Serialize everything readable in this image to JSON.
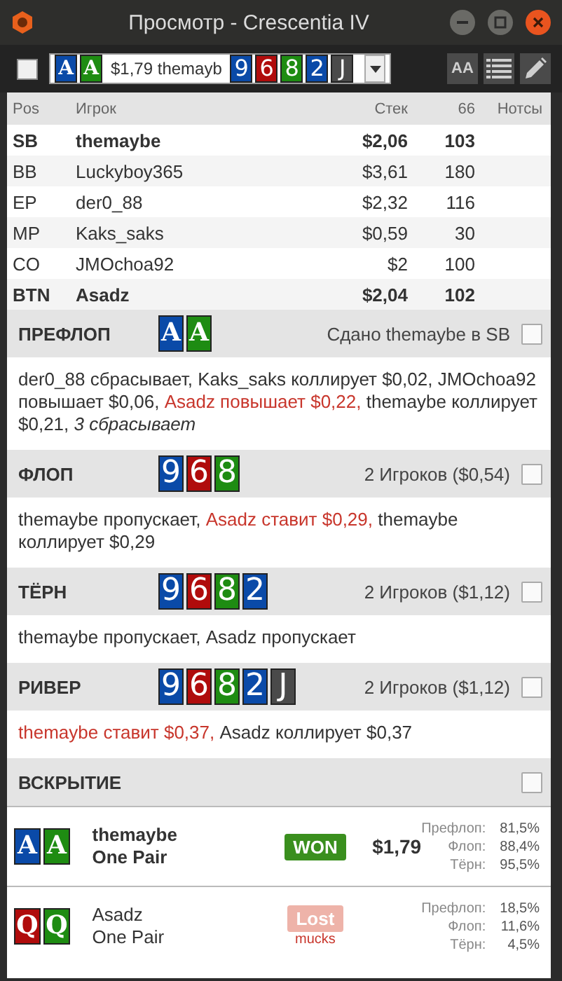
{
  "window": {
    "title": "Просмотр - Crescentia IV"
  },
  "toolbar": {
    "checked": false,
    "hand_cards": [
      {
        "rank": "A",
        "color": "#0a4aa8"
      },
      {
        "rank": "A",
        "color": "#1e8c12"
      }
    ],
    "hand_text": "$1,79 themayb",
    "board_cards": [
      {
        "rank": "9",
        "color": "#0a4aa8"
      },
      {
        "rank": "6",
        "color": "#b00c0c"
      },
      {
        "rank": "8",
        "color": "#1e8c12"
      },
      {
        "rank": "2",
        "color": "#0a4aa8"
      },
      {
        "rank": "J",
        "color": "#4a4a4a"
      }
    ],
    "font_button": "AA"
  },
  "table": {
    "columns": [
      "Pos",
      "Игрок",
      "Стек",
      "66",
      "Нотсы"
    ],
    "rows": [
      {
        "pos": "SB",
        "player": "themaybe",
        "stack": "$2,06",
        "hands": "103",
        "bold": true
      },
      {
        "pos": "BB",
        "player": "Luckyboy365",
        "stack": "$3,61",
        "hands": "180",
        "bold": false
      },
      {
        "pos": "EP",
        "player": "der0_88",
        "stack": "$2,32",
        "hands": "116",
        "bold": false
      },
      {
        "pos": "MP",
        "player": "Kaks_saks",
        "stack": "$0,59",
        "hands": "30",
        "bold": false
      },
      {
        "pos": "CO",
        "player": "JMOchoa92",
        "stack": "$2",
        "hands": "100",
        "bold": false
      },
      {
        "pos": "BTN",
        "player": "Asadz",
        "stack": "$2,04",
        "hands": "102",
        "bold": true
      }
    ]
  },
  "streets": [
    {
      "name": "ПРЕФЛОП",
      "cards": [
        {
          "rank": "A",
          "color": "#0a4aa8"
        },
        {
          "rank": "A",
          "color": "#1e8c12"
        }
      ],
      "info": "Сдано themaybe в SB",
      "actions": [
        {
          "text": "der0_88 сбрасывает, Kaks_saks коллирует $0,02, JMOchoa92 повышает $0,06, ",
          "kind": "plain"
        },
        {
          "text": "Asadz повышает $0,22,",
          "kind": "hero"
        },
        {
          "text": " themaybe коллирует $0,21, ",
          "kind": "plain"
        },
        {
          "text": "3 сбрасывает",
          "kind": "folds"
        }
      ]
    },
    {
      "name": "ФЛОП",
      "cards": [
        {
          "rank": "9",
          "color": "#0a4aa8"
        },
        {
          "rank": "6",
          "color": "#b00c0c"
        },
        {
          "rank": "8",
          "color": "#1e8c12"
        }
      ],
      "info": "2 Игроков ($0,54)",
      "actions": [
        {
          "text": "themaybe пропускает, ",
          "kind": "plain"
        },
        {
          "text": "Asadz ставит $0,29,",
          "kind": "hero"
        },
        {
          "text": " themaybe коллирует $0,29",
          "kind": "plain"
        }
      ]
    },
    {
      "name": "ТЁРН",
      "cards": [
        {
          "rank": "9",
          "color": "#0a4aa8"
        },
        {
          "rank": "6",
          "color": "#b00c0c"
        },
        {
          "rank": "8",
          "color": "#1e8c12"
        },
        {
          "rank": "2",
          "color": "#0a4aa8"
        }
      ],
      "info": "2 Игроков ($1,12)",
      "actions": [
        {
          "text": "themaybe пропускает, Asadz пропускает",
          "kind": "plain"
        }
      ]
    },
    {
      "name": "РИВЕР",
      "cards": [
        {
          "rank": "9",
          "color": "#0a4aa8"
        },
        {
          "rank": "6",
          "color": "#b00c0c"
        },
        {
          "rank": "8",
          "color": "#1e8c12"
        },
        {
          "rank": "2",
          "color": "#0a4aa8"
        },
        {
          "rank": "J",
          "color": "#4a4a4a"
        }
      ],
      "info": "2 Игроков ($1,12)",
      "actions": [
        {
          "text": "themaybe ставит $0,37,",
          "kind": "hero"
        },
        {
          "text": " Asadz коллирует $0,37",
          "kind": "plain"
        }
      ]
    }
  ],
  "showdown": {
    "title": "ВСКРЫТИЕ",
    "players": [
      {
        "name": "themaybe",
        "hand": "One Pair",
        "bold": true,
        "cards": [
          {
            "rank": "A",
            "color": "#0a4aa8"
          },
          {
            "rank": "A",
            "color": "#1e8c12"
          }
        ],
        "result": {
          "kind": "won",
          "label": "WON"
        },
        "amount": "$1,79",
        "stats": [
          {
            "label": "Префлоп:",
            "value": "81,5%"
          },
          {
            "label": "Флоп:",
            "value": "88,4%"
          },
          {
            "label": "Тёрн:",
            "value": "95,5%"
          }
        ]
      },
      {
        "name": "Asadz",
        "hand": "One Pair",
        "bold": false,
        "cards": [
          {
            "rank": "Q",
            "color": "#b00c0c"
          },
          {
            "rank": "Q",
            "color": "#1e8c12"
          }
        ],
        "result": {
          "kind": "lost",
          "label": "Lost"
        },
        "note": "mucks",
        "stats": [
          {
            "label": "Префлоп:",
            "value": "18,5%"
          },
          {
            "label": "Флоп:",
            "value": "11,6%"
          },
          {
            "label": "Тёрн:",
            "value": "4,5%"
          }
        ]
      }
    ]
  }
}
